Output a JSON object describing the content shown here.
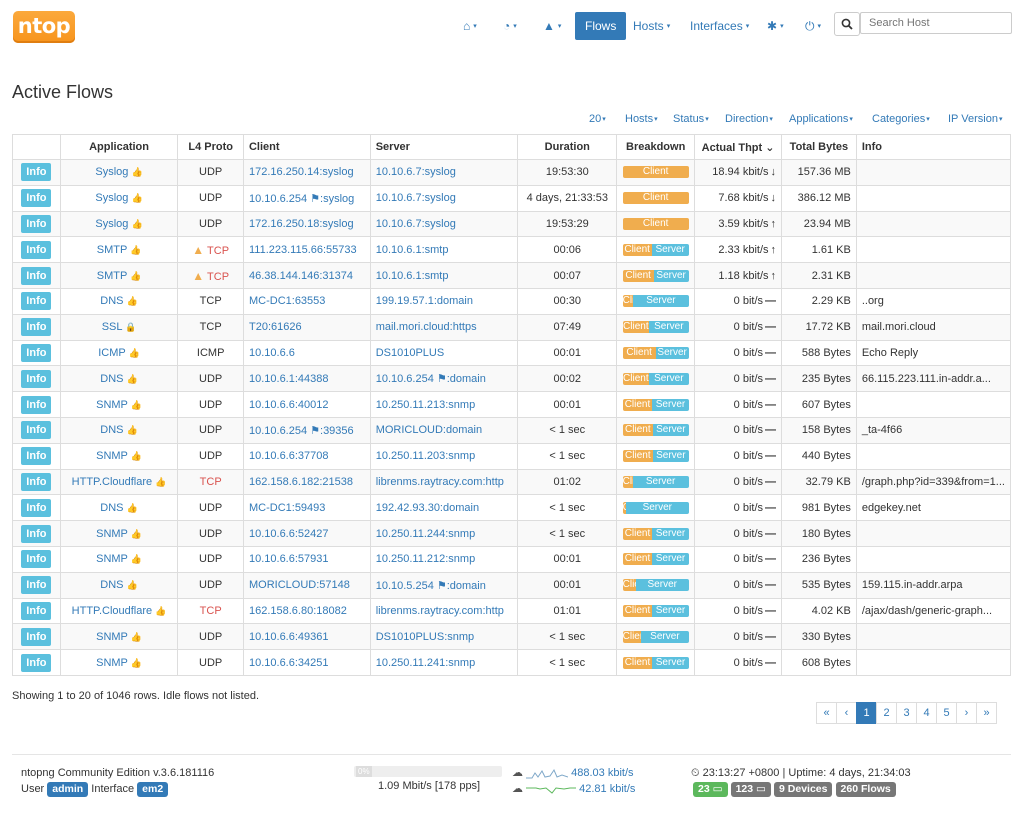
{
  "nav": {
    "logo": "ntop",
    "home": "⌂",
    "dashboard": "◔",
    "alerts": "▲",
    "flows": "Flows",
    "hosts": "Hosts",
    "interfaces": "Interfaces",
    "settings": "✱",
    "power": "⏻",
    "search_placeholder": "Search Host",
    "caret": "▾"
  },
  "page_title": "Active Flows",
  "filters": [
    "20",
    "Hosts",
    "Status",
    "Direction",
    "Applications",
    "Categories",
    "IP Version"
  ],
  "columns": [
    "",
    "Application",
    "L4 Proto",
    "Client",
    "Server",
    "Duration",
    "Breakdown",
    "Actual Thpt",
    "Total Bytes",
    "Info"
  ],
  "info_label": "Info",
  "breakdown_labels": {
    "client": "Client",
    "server": "Server"
  },
  "rows": [
    {
      "app": "Syslog",
      "app_icon": "thumbs-up",
      "proto": "UDP",
      "warn": false,
      "client": "172.16.250.14:syslog",
      "server": "10.10.6.7:syslog",
      "duration": "19:53:30",
      "client_pct": 100,
      "thpt": "18.94 kbit/s",
      "trend": "↓",
      "bytes": "157.36 MB",
      "info": ""
    },
    {
      "app": "Syslog",
      "app_icon": "thumbs-up",
      "proto": "UDP",
      "warn": false,
      "client": "10.10.6.254 ⚑:syslog",
      "server": "10.10.6.7:syslog",
      "duration": "4 days, 21:33:53",
      "client_pct": 100,
      "thpt": "7.68 kbit/s",
      "trend": "↓",
      "bytes": "386.12 MB",
      "info": ""
    },
    {
      "app": "Syslog",
      "app_icon": "thumbs-up",
      "proto": "UDP",
      "warn": false,
      "client": "172.16.250.18:syslog",
      "server": "10.10.6.7:syslog",
      "duration": "19:53:29",
      "client_pct": 100,
      "thpt": "3.59 kbit/s",
      "trend": "↑",
      "bytes": "23.94 MB",
      "info": ""
    },
    {
      "app": "SMTP",
      "app_icon": "thumbs-up",
      "proto": "TCP",
      "warn": true,
      "client": "111.223.115.66:55733",
      "server": "10.10.6.1:smtp",
      "duration": "00:06",
      "client_pct": 44,
      "thpt": "2.33 kbit/s",
      "trend": "↑",
      "bytes": "1.61 KB",
      "info": ""
    },
    {
      "app": "SMTP",
      "app_icon": "thumbs-up",
      "proto": "TCP",
      "warn": true,
      "client": "46.38.144.146:31374",
      "server": "10.10.6.1:smtp",
      "duration": "00:07",
      "client_pct": 47,
      "thpt": "1.18 kbit/s",
      "trend": "↑",
      "bytes": "2.31 KB",
      "info": ""
    },
    {
      "app": "DNS",
      "app_icon": "thumbs-up",
      "proto": "TCP",
      "warn": false,
      "client": "MC-DC1:63553",
      "server": "199.19.57.1:domain",
      "duration": "00:30",
      "client_pct": 16,
      "thpt": "0 bit/s",
      "trend": "—",
      "bytes": "2.29 KB",
      "info": "..org"
    },
    {
      "app": "SSL",
      "app_icon": "lock",
      "proto": "TCP",
      "warn": false,
      "client": "T20:61626",
      "server": "mail.mori.cloud:https",
      "duration": "07:49",
      "client_pct": 40,
      "thpt": "0 bit/s",
      "trend": "—",
      "bytes": "17.72 KB",
      "info": "mail.mori.cloud"
    },
    {
      "app": "ICMP",
      "app_icon": "thumbs-up",
      "proto": "ICMP",
      "warn": false,
      "client": "10.10.6.6",
      "server": "DS1010PLUS",
      "duration": "00:01",
      "client_pct": 50,
      "thpt": "0 bit/s",
      "trend": "—",
      "bytes": "588 Bytes",
      "info": "Echo Reply"
    },
    {
      "app": "DNS",
      "app_icon": "thumbs-up",
      "proto": "UDP",
      "warn": false,
      "client": "10.10.6.1:44388",
      "server": "10.10.6.254 ⚑:domain",
      "duration": "00:02",
      "client_pct": 40,
      "thpt": "0 bit/s",
      "trend": "—",
      "bytes": "235 Bytes",
      "info": "66.115.223.111.in-addr.a..."
    },
    {
      "app": "SNMP",
      "app_icon": "thumbs-up",
      "proto": "UDP",
      "warn": false,
      "client": "10.10.6.6:40012",
      "server": "10.250.11.213:snmp",
      "duration": "00:01",
      "client_pct": 45,
      "thpt": "0 bit/s",
      "trend": "—",
      "bytes": "607 Bytes",
      "info": ""
    },
    {
      "app": "DNS",
      "app_icon": "thumbs-up",
      "proto": "UDP",
      "warn": false,
      "client": "10.10.6.254 ⚑:39356",
      "server": "MORICLOUD:domain",
      "duration": "< 1 sec",
      "client_pct": 46,
      "thpt": "0 bit/s",
      "trend": "—",
      "bytes": "158 Bytes",
      "info": "_ta-4f66"
    },
    {
      "app": "SNMP",
      "app_icon": "thumbs-up",
      "proto": "UDP",
      "warn": false,
      "client": "10.10.6.6:37708",
      "server": "10.250.11.203:snmp",
      "duration": "< 1 sec",
      "client_pct": 46,
      "thpt": "0 bit/s",
      "trend": "—",
      "bytes": "440 Bytes",
      "info": ""
    },
    {
      "app": "HTTP.Cloudflare",
      "app_icon": "thumbs-up",
      "proto": "TCP",
      "warn": false,
      "proto_red": true,
      "client": "162.158.6.182:21538",
      "server": "librenms.raytracy.com:http",
      "duration": "01:02",
      "client_pct": 15,
      "thpt": "0 bit/s",
      "trend": "—",
      "bytes": "32.79 KB",
      "info": "/graph.php?id=339&from=1..."
    },
    {
      "app": "DNS",
      "app_icon": "thumbs-up",
      "proto": "UDP",
      "warn": false,
      "client": "MC-DC1:59493",
      "server": "192.42.93.30:domain",
      "duration": "< 1 sec",
      "client_pct": 5,
      "thpt": "0 bit/s",
      "trend": "—",
      "bytes": "981 Bytes",
      "info": "edgekey.net"
    },
    {
      "app": "SNMP",
      "app_icon": "thumbs-up",
      "proto": "UDP",
      "warn": false,
      "client": "10.10.6.6:52427",
      "server": "10.250.11.244:snmp",
      "duration": "< 1 sec",
      "client_pct": 45,
      "thpt": "0 bit/s",
      "trend": "—",
      "bytes": "180 Bytes",
      "info": ""
    },
    {
      "app": "SNMP",
      "app_icon": "thumbs-up",
      "proto": "UDP",
      "warn": false,
      "client": "10.10.6.6:57931",
      "server": "10.250.11.212:snmp",
      "duration": "00:01",
      "client_pct": 45,
      "thpt": "0 bit/s",
      "trend": "—",
      "bytes": "236 Bytes",
      "info": ""
    },
    {
      "app": "DNS",
      "app_icon": "thumbs-up",
      "proto": "UDP",
      "warn": false,
      "client": "MORICLOUD:57148",
      "server": "10.10.5.254 ⚑:domain",
      "duration": "00:01",
      "client_pct": 20,
      "thpt": "0 bit/s",
      "trend": "—",
      "bytes": "535 Bytes",
      "info": "159.115.in-addr.arpa"
    },
    {
      "app": "HTTP.Cloudflare",
      "app_icon": "thumbs-up",
      "proto": "TCP",
      "warn": false,
      "proto_red": true,
      "client": "162.158.6.80:18082",
      "server": "librenms.raytracy.com:http",
      "duration": "01:01",
      "client_pct": 45,
      "thpt": "0 bit/s",
      "trend": "—",
      "bytes": "4.02 KB",
      "info": "/ajax/dash/generic-graph..."
    },
    {
      "app": "SNMP",
      "app_icon": "thumbs-up",
      "proto": "UDP",
      "warn": false,
      "client": "10.10.6.6:49361",
      "server": "DS1010PLUS:snmp",
      "duration": "< 1 sec",
      "client_pct": 28,
      "thpt": "0 bit/s",
      "trend": "—",
      "bytes": "330 Bytes",
      "info": ""
    },
    {
      "app": "SNMP",
      "app_icon": "thumbs-up",
      "proto": "UDP",
      "warn": false,
      "client": "10.10.6.6:34251",
      "server": "10.250.11.241:snmp",
      "duration": "< 1 sec",
      "client_pct": 45,
      "thpt": "0 bit/s",
      "trend": "—",
      "bytes": "608 Bytes",
      "info": ""
    }
  ],
  "showing": "Showing 1 to 20 of 1046 rows. Idle flows not listed.",
  "pagination": [
    "«",
    "‹",
    "1",
    "2",
    "3",
    "4",
    "5",
    "›",
    "»"
  ],
  "pagination_active": "1",
  "footer": {
    "edition": "ntopng Community Edition v.3.6.181116",
    "user_label": "User",
    "user": "admin",
    "interface_label": "Interface",
    "interface": "em2",
    "gauge_label": "0%",
    "traffic": "1.09 Mbit/s [178 pps]",
    "upload": "488.03 kbit/s",
    "download": "42.81 kbit/s",
    "clock": "⏲ 23:13:27 +0800 | Uptime: 4 days, 21:34:03",
    "badges": [
      {
        "text": "23 ▭",
        "style": "success"
      },
      {
        "text": "123 ▭",
        "style": "default"
      },
      {
        "text": "9 Devices",
        "style": "default"
      },
      {
        "text": "260 Flows",
        "style": "default"
      }
    ]
  }
}
